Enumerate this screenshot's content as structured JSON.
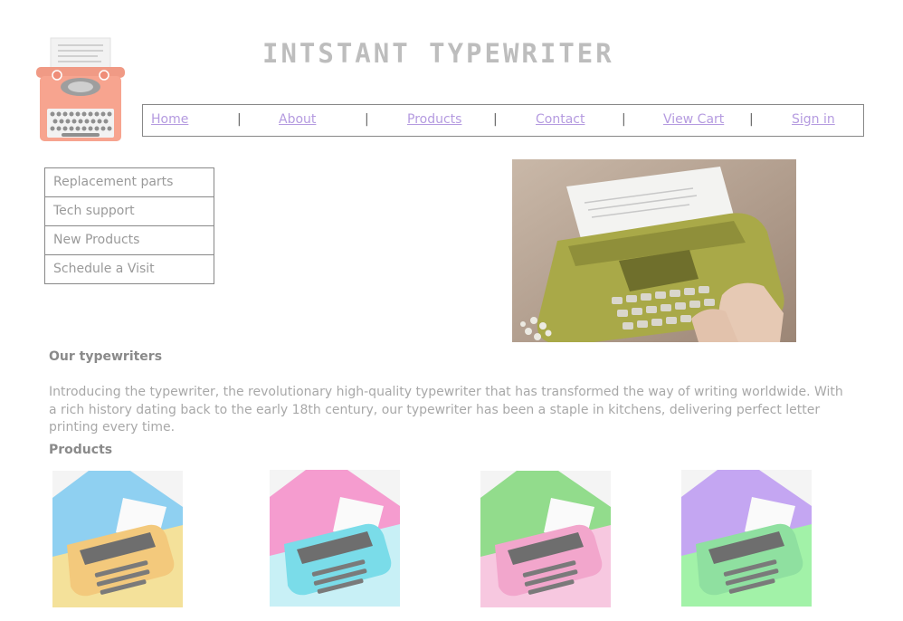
{
  "header": {
    "title": "INTSTANT TYPEWRITER"
  },
  "colors": {
    "nav_link": "#b59be0",
    "logo_body": "#f7a48f",
    "text": "#8a8a8a"
  },
  "nav": {
    "items": [
      {
        "label": "Home"
      },
      {
        "label": "About"
      },
      {
        "label": "Products"
      },
      {
        "label": "Contact"
      },
      {
        "label": "View Cart"
      },
      {
        "label": "Sign in"
      }
    ],
    "separator": "|"
  },
  "sidebar": {
    "items": [
      {
        "label": "Replacement parts"
      },
      {
        "label": "Tech support"
      },
      {
        "label": "New Products"
      },
      {
        "label": "Schedule a Visit"
      }
    ]
  },
  "main": {
    "heading": "Our typewriters",
    "intro": "Introducing the typewriter, the revolutionary high-quality typewriter that has transformed the way of writing worldwide. With a rich history dating back to the early 18th century, our typewriter has been a staple in kitchens, delivering perfect letter printing every time.",
    "products_heading": "Products"
  },
  "products": [
    {
      "icon": "yellow-typewriter-on-blue-image"
    },
    {
      "icon": "cyan-typewriter-on-pink-image"
    },
    {
      "icon": "pink-typewriter-on-green-image"
    },
    {
      "icon": "green-typewriter-on-purple-image"
    }
  ]
}
